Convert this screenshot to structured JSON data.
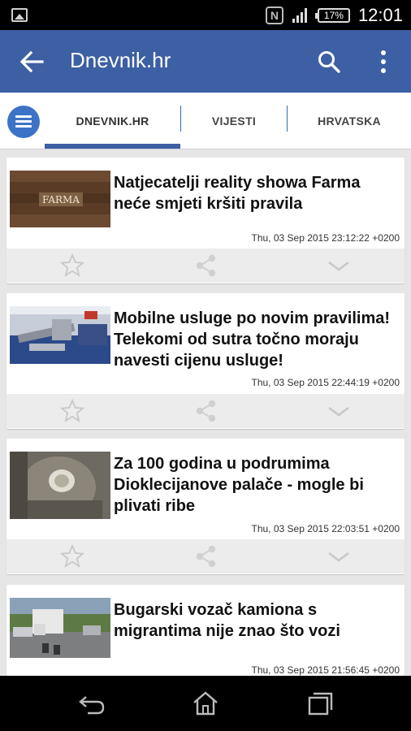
{
  "status_bar": {
    "battery_percent": "17%",
    "time": "12:01",
    "icons": [
      "image-icon",
      "nfc-icon",
      "signal-icon",
      "battery-icon"
    ]
  },
  "app_bar": {
    "title": "Dnevnik.hr",
    "color": "#3d5fa3",
    "icons": [
      "back-arrow-icon",
      "search-icon",
      "more-vert-icon"
    ]
  },
  "tabs": {
    "items": [
      {
        "label": "DNEVNIK.HR",
        "active": true
      },
      {
        "label": "VIJESTI",
        "active": false
      },
      {
        "label": "HRVATSKA",
        "active": false
      }
    ],
    "menu_icon": "menu-icon"
  },
  "articles": [
    {
      "headline": "Natjecatelji reality showa Farma neće smjeti kršiti pravila",
      "date": "Thu, 03 Sep 2015 23:12:22 +0200",
      "thumb_label": "FARMA"
    },
    {
      "headline": "Mobilne usluge po novim pravilima! Telekomi od sutra točno moraju navesti cijenu usluge!",
      "date": "Thu, 03 Sep 2015 22:44:19 +0200"
    },
    {
      "headline": "Za 100 godina u podrumima Dioklecijanove palače - mogle bi plivati ribe",
      "date": "Thu, 03 Sep 2015 22:03:51 +0200"
    },
    {
      "headline": "Bugarski vozač kamiona s migrantima nije znao što vozi",
      "date": "Thu, 03 Sep 2015 21:56:45 +0200"
    }
  ],
  "card_actions": [
    "star-icon",
    "share-icon",
    "chevron-down-icon"
  ],
  "nav_bar": {
    "icons": [
      "back-nav-icon",
      "home-icon",
      "recents-icon"
    ]
  }
}
